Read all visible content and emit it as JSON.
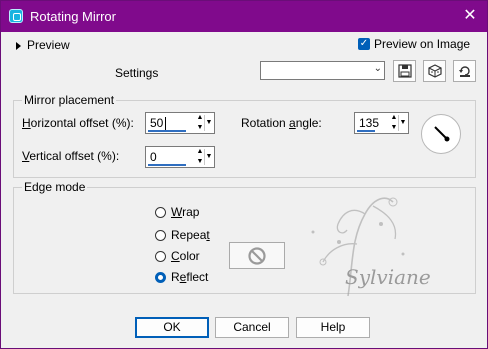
{
  "window": {
    "title": "Rotating Mirror",
    "close_glyph": "✕",
    "title_bar_color": "#800a8c"
  },
  "preview_section": {
    "label": "Preview"
  },
  "preview_on_image": {
    "label": "Preview on Image",
    "checked": true,
    "check_glyph": "✓"
  },
  "settings": {
    "label": "Settings",
    "value": "",
    "dropdown_glyph": "⌄"
  },
  "toolbar": {
    "save_icon": "save-icon",
    "randomize_icon": "dice-icon",
    "reset_icon": "reset-icon"
  },
  "mirror_placement": {
    "title": "Mirror placement",
    "horizontal_offset": {
      "label_pre": "",
      "label_underline": "H",
      "label_post": "orizontal offset (%):",
      "value": "50"
    },
    "vertical_offset": {
      "label_pre": "",
      "label_underline": "V",
      "label_post": "ertical offset (%):",
      "value": "0"
    },
    "rotation_angle": {
      "label_pre": "Rotation ",
      "label_underline": "a",
      "label_post": "ngle:",
      "value": "135"
    }
  },
  "edge_mode": {
    "title": "Edge mode",
    "options": [
      {
        "label_pre": "",
        "label_underline": "W",
        "label_post": "rap",
        "selected": false
      },
      {
        "label_pre": "Repea",
        "label_underline": "t",
        "label_post": "",
        "selected": false
      },
      {
        "label_pre": "",
        "label_underline": "C",
        "label_post": "olor",
        "selected": false
      },
      {
        "label_pre": "R",
        "label_underline": "e",
        "label_post": "flect",
        "selected": true
      }
    ],
    "color_swatch_icon": "no-entry-icon"
  },
  "watermark": {
    "text": "Sylviane"
  },
  "buttons": {
    "ok": "OK",
    "cancel": "Cancel",
    "help": "Help"
  },
  "colors": {
    "accent": "#005fb8"
  }
}
